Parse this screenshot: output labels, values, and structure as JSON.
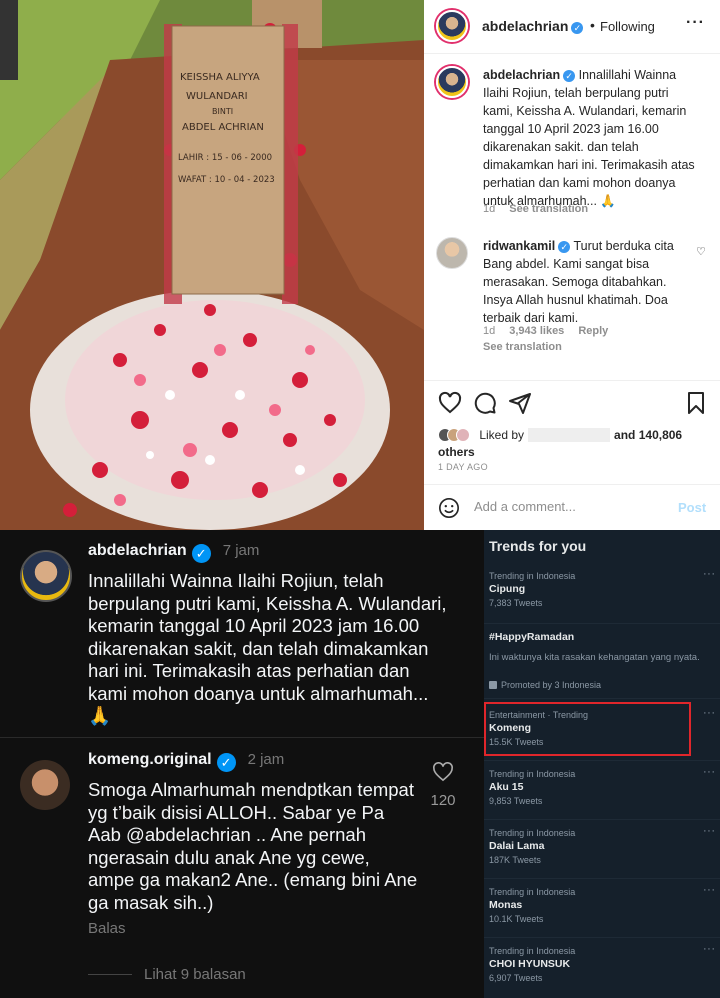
{
  "instagram": {
    "header": {
      "username": "abdelachrian",
      "separator": "•",
      "follow_status": "Following",
      "more_icon": "more-horizontal-icon"
    },
    "caption": {
      "username": "abdelachrian",
      "text": "Innalillahi Wainna Ilaihi Rojiun, telah berpulang putri kami, Keissha A. Wulandari, kemarin tanggal 10 April 2023 jam 16.00 dikarenakan sakit. dan telah dimakamkan hari ini. Terimakasih atas perhatian dan kami mohon doanya untuk almarhumah... 🙏",
      "age": "1d",
      "see_translation": "See translation"
    },
    "comment": {
      "username": "ridwankamil",
      "text": "Turut berduka cita Bang abdel. Kami sangat bisa merasakan. Semoga ditabahkan. Insya Allah husnul khatimah. Doa terbaik dari kami.",
      "age": "1d",
      "likes": "3,943 likes",
      "reply": "Reply",
      "see_translation": "See translation"
    },
    "likes": {
      "prefix": "Liked by",
      "suffix": "and 140,806",
      "others": "others"
    },
    "date": "1 DAY AGO",
    "add_comment_placeholder": "Add a comment...",
    "post_label": "Post",
    "photo": {
      "plaque_lines": [
        "KEISSHA ALIYYA",
        "WULANDARI",
        "BINTI",
        "ABDEL ACHRIAN",
        "LAHIR : 15 - 06 - 2000",
        "WAFAT : 10 - 04 - 2023"
      ]
    }
  },
  "threads": {
    "post": {
      "username": "abdelachrian",
      "time": "7 jam",
      "text": "Innalillahi Wainna Ilaihi Rojiun, telah berpulang putri kami, Keissha A. Wulandari, kemarin tanggal 10 April 2023 jam 16.00 dikarenakan sakit, dan telah dimakamkan hari ini. Terimakasih atas perhatian dan kami mohon doanya untuk almarhumah... 🙏"
    },
    "reply": {
      "username": "komeng.original",
      "time": "2 jam",
      "text": "Smoga Almarhumah mendptkan tempat yg t’baik disisi ALLOH.. Sabar ye Pa Aab @abdelachrian .. Ane pernah ngerasain dulu anak Ane yg cewe, ampe ga makan2 Ane.. (emang bini Ane ga masak sih..)",
      "like_count": "120",
      "reply_label": "Balas",
      "view_replies": "Lihat 9 balasan"
    }
  },
  "twitter": {
    "title": "Trends for you",
    "trends": [
      {
        "category": "Trending in Indonesia",
        "name": "Cipung",
        "count": "7,383 Tweets"
      },
      {
        "category": "",
        "name": "#HappyRamadan",
        "description": "Ini waktunya kita rasakan kehangatan yang nyata.",
        "promoted_by": "Promoted by 3 Indonesia"
      },
      {
        "category": "Entertainment · Trending",
        "name": "Komeng",
        "count": "15.5K Tweets"
      },
      {
        "category": "Trending in Indonesia",
        "name": "Aku 15",
        "count": "9,853 Tweets"
      },
      {
        "category": "Trending in Indonesia",
        "name": "Dalai Lama",
        "count": "187K Tweets"
      },
      {
        "category": "Trending in Indonesia",
        "name": "Monas",
        "count": "10.1K Tweets"
      },
      {
        "category": "Trending in Indonesia",
        "name": "CHOI HYUNSUK",
        "count": "6,907 Tweets"
      }
    ],
    "more_label": "···",
    "highlight_color": "#e0262b"
  }
}
